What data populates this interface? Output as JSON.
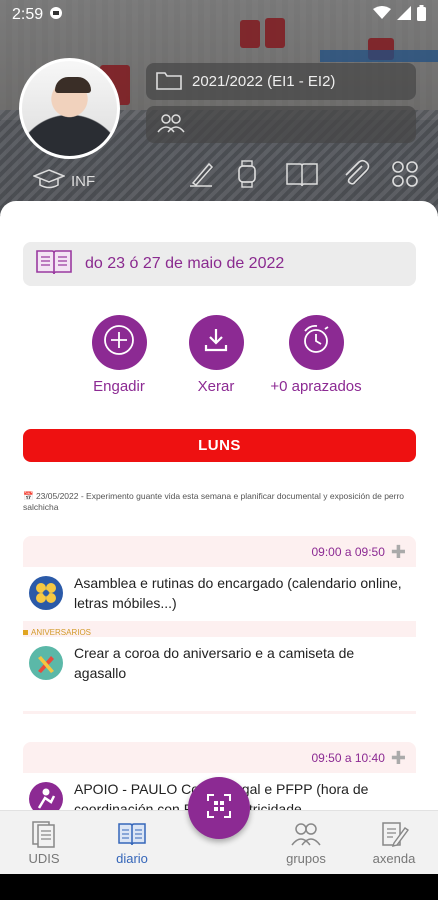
{
  "status_bar": {
    "time": "2:59"
  },
  "header": {
    "course_label": "2021/2022 (EI1 - EI2)",
    "groups_label": "",
    "level_label": "INF",
    "tools": [
      "pen-icon",
      "watch-icon",
      "book-icon",
      "clip-icon",
      "grid-icon"
    ]
  },
  "week": {
    "label": "do 23 ó 27 de maio de 2022"
  },
  "actions": {
    "add_label": "Engadir",
    "generate_label": "Xerar",
    "postponed_label": "+0 aprazados"
  },
  "day": {
    "label": "LUNS",
    "note": "📅 23/05/2022 - Experimento guante vida esta semana e planificar documental y exposición de perro salchicha"
  },
  "slots": [
    {
      "time": "09:00 a 09:50",
      "entries": [
        {
          "tag": "",
          "text": "Asamblea e rutinas do encargado (calendario online, letras móbiles...)"
        },
        {
          "tag": "ANIVERSARIOS",
          "text": "Crear a coroa do aniversario e a camiseta de agasallo"
        }
      ]
    },
    {
      "time": "09:50 a 10:40",
      "entries": [
        {
          "tag": "",
          "text": "APOIO - PAULO  Co           n Edixgal e PFPP  (hora de coordinación con P              psicomotricidade"
        }
      ]
    }
  ],
  "bottom_nav": {
    "udis": "UDIS",
    "diario": "diario",
    "grupos": "grupos",
    "axenda": "axenda"
  },
  "colors": {
    "accent": "#8c2a93",
    "day_red": "#ee1111",
    "nav_active": "#3566b9"
  }
}
